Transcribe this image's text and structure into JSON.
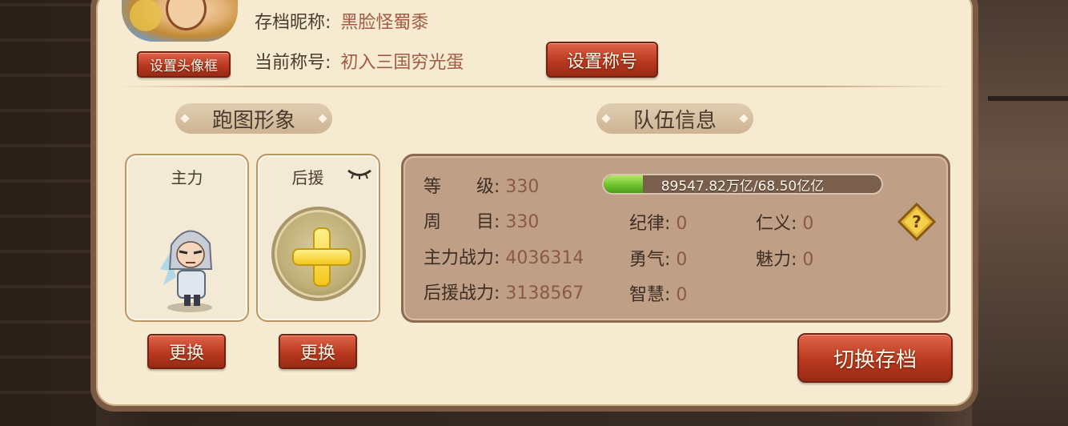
{
  "profile": {
    "nickname_label": "存档昵称:",
    "nickname_value": "黑脸怪蜀黍",
    "title_label": "当前称号:",
    "title_value": "初入三国穷光蛋",
    "avatar_frame_button": "设置头像框",
    "set_title_button": "设置称号"
  },
  "sections": {
    "appearance": "跑图形象",
    "team_info": "队伍信息"
  },
  "cards": {
    "main_label": "主力",
    "support_label": "后援",
    "change_button_main": "更换",
    "change_button_support": "更换"
  },
  "stats": {
    "level_label": "等　　级:",
    "level_value": "330",
    "exp_text": "89547.82万亿/68.50亿亿",
    "exp_progress": 0.14,
    "cycle_label": "周　　目:",
    "cycle_value": "330",
    "main_power_label": "主力战力:",
    "main_power_value": "4036314",
    "support_power_label": "后援战力:",
    "support_power_value": "3138567",
    "discipline_label": "纪律:",
    "discipline_value": "0",
    "courage_label": "勇气:",
    "courage_value": "0",
    "wisdom_label": "智慧:",
    "wisdom_value": "0",
    "benevolence_label": "仁义:",
    "benevolence_value": "0",
    "charm_label": "魅力:",
    "charm_value": "0"
  },
  "switch_save_button": "切换存档",
  "icons": {
    "help": "question-mark-diamond-icon",
    "hide": "closed-eye-icon",
    "add": "plus-icon"
  }
}
